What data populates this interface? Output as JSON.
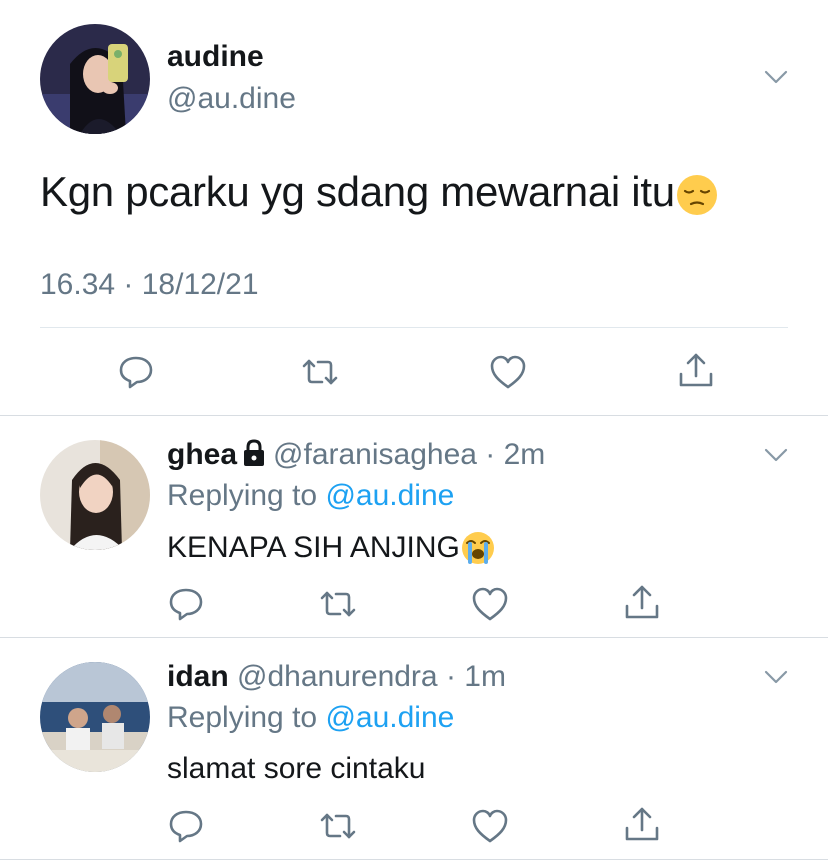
{
  "main_tweet": {
    "author_name": "audine",
    "handle": "@au.dine",
    "text": "Kgn pcarku yg sdang mewarnai itu",
    "text_emoji": "pensive-face-emoji",
    "timestamp": "16.34 · 18/12/21",
    "actions": [
      "reply-icon",
      "retweet-icon",
      "like-icon",
      "share-icon"
    ]
  },
  "replies": [
    {
      "author_name": "ghea",
      "protected": true,
      "handle": "@faranisaghea",
      "time": "2m",
      "replying_label": "Replying to",
      "replying_to": "@au.dine",
      "text": "KENAPA SIH ANJING",
      "text_emoji": "loudly-crying-face-emoji"
    },
    {
      "author_name": "idan",
      "protected": false,
      "handle": "@dhanurendra",
      "time": "1m",
      "replying_label": "Replying to",
      "replying_to": "@au.dine",
      "text": "slamat sore cintaku"
    }
  ],
  "colors": {
    "text": "#14171a",
    "secondary": "#657786",
    "link": "#1da1f2",
    "divider": "#e1e8ed"
  }
}
